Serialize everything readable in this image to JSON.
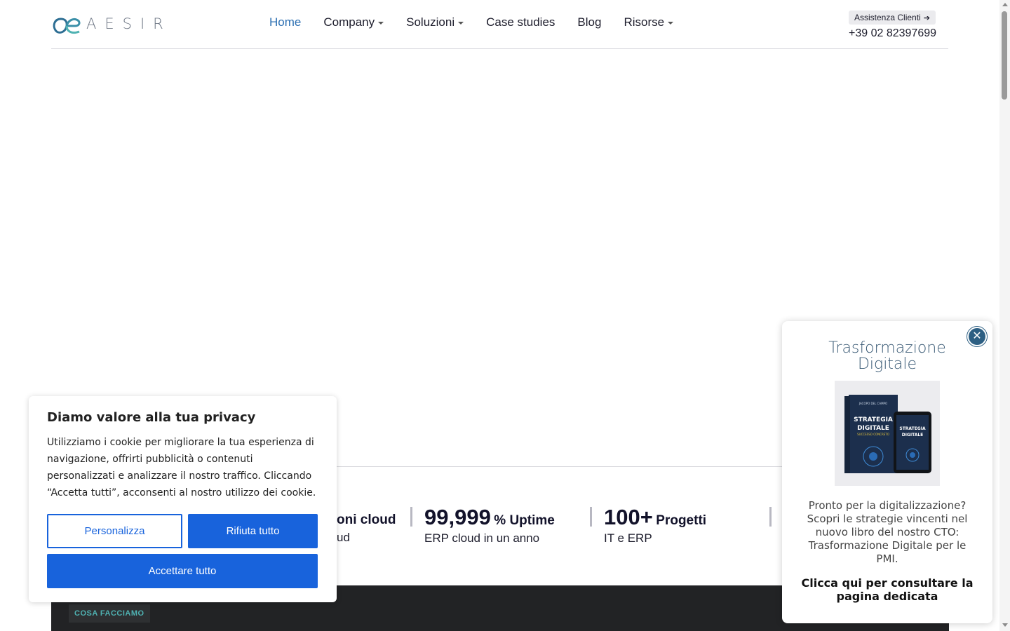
{
  "brand": {
    "name": "AESIR"
  },
  "nav": {
    "items": [
      {
        "label": "Home",
        "active": true,
        "has_dropdown": false
      },
      {
        "label": "Company",
        "active": false,
        "has_dropdown": true
      },
      {
        "label": "Soluzioni",
        "active": false,
        "has_dropdown": true
      },
      {
        "label": "Case studies",
        "active": false,
        "has_dropdown": false
      },
      {
        "label": "Blog",
        "active": false,
        "has_dropdown": false
      },
      {
        "label": "Risorse",
        "active": false,
        "has_dropdown": true
      }
    ]
  },
  "support": {
    "label": "Assistenza Clienti",
    "phone": "+39 02 82397699"
  },
  "stats": {
    "partial_title": "oni cloud",
    "partial_sub": "ud",
    "uptime_value": "99,999",
    "uptime_unit": "% Uptime",
    "uptime_sub": "ERP cloud in un anno",
    "projects_value": "100+",
    "projects_unit": "Progetti",
    "projects_sub": "IT e ERP"
  },
  "section": {
    "badge": "COSA FACCIAMO"
  },
  "cookie": {
    "title": "Diamo valore alla tua privacy",
    "body": "Utilizziamo i cookie per migliorare la tua esperienza di navigazione, offrirti pubblicità o contenuti personalizzati e analizzare il nostro traffico. Cliccando “Accetta tutti”, acconsenti al nostro utilizzo dei cookie.",
    "customize_label": "Personalizza",
    "reject_label": "Rifiuta tutto",
    "accept_label": "Accettare tutto"
  },
  "promo": {
    "title": "Trasformazione Digitale",
    "text": "Pronto per la digitalizzazione? Scopri le strategie vincenti nel nuovo libro del nostro CTO: Trasformazione Digitale per le PMI.",
    "link": "Clicca qui per consultare la pagina dedicata",
    "book_title": "STRATEGIA DIGITALE",
    "book_subtitle": "SUCCESSO CONCRETO",
    "book_author": "JACOPO DEL CAMPO",
    "close_icon": "close-icon"
  },
  "colors": {
    "accent": "#1863dc",
    "nav_active": "#2c6fb2",
    "teal": "#4fb2b2",
    "dark": "#222325"
  }
}
